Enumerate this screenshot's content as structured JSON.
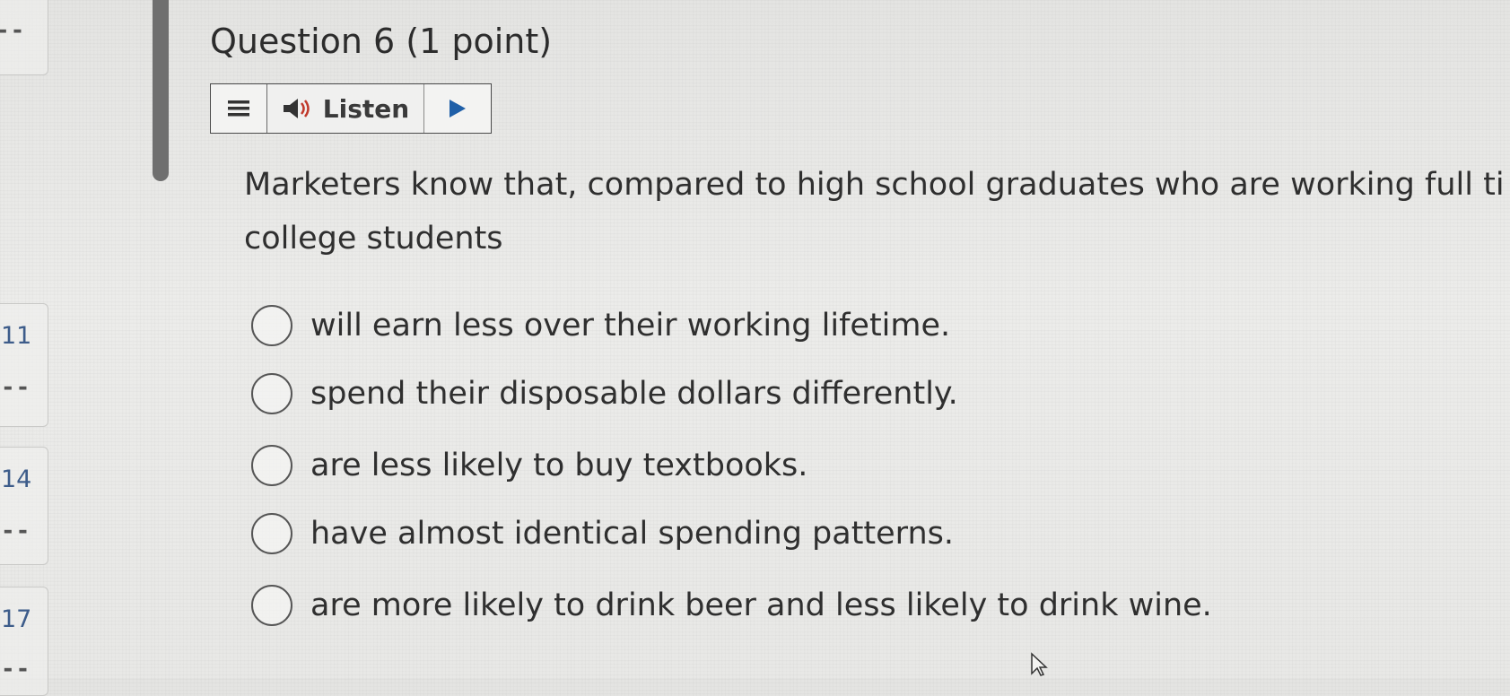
{
  "question": {
    "title": "Question 6 (1 point)",
    "prompt_line1": "Marketers know that, compared to high school graduates who are working full ti",
    "prompt_line2": "college students"
  },
  "toolbar": {
    "menu_icon": "hamburger-menu-icon",
    "speaker_icon": "speaker-icon",
    "listen_label": "Listen",
    "play_icon": "play-icon"
  },
  "options": [
    {
      "label": "will earn less over their working lifetime."
    },
    {
      "label": "spend their disposable dollars differently."
    },
    {
      "label": "are less likely to buy textbooks."
    },
    {
      "label": "have almost identical spending patterns."
    },
    {
      "label": "are more likely to drink beer and less likely to drink wine."
    }
  ],
  "navigator": {
    "numbers": [
      "11",
      "14",
      "17"
    ],
    "dash": "--"
  },
  "colors": {
    "nav_number": "#3d5c8a",
    "text": "#2f2f2f",
    "scrollbar": "#6f6f6f"
  }
}
